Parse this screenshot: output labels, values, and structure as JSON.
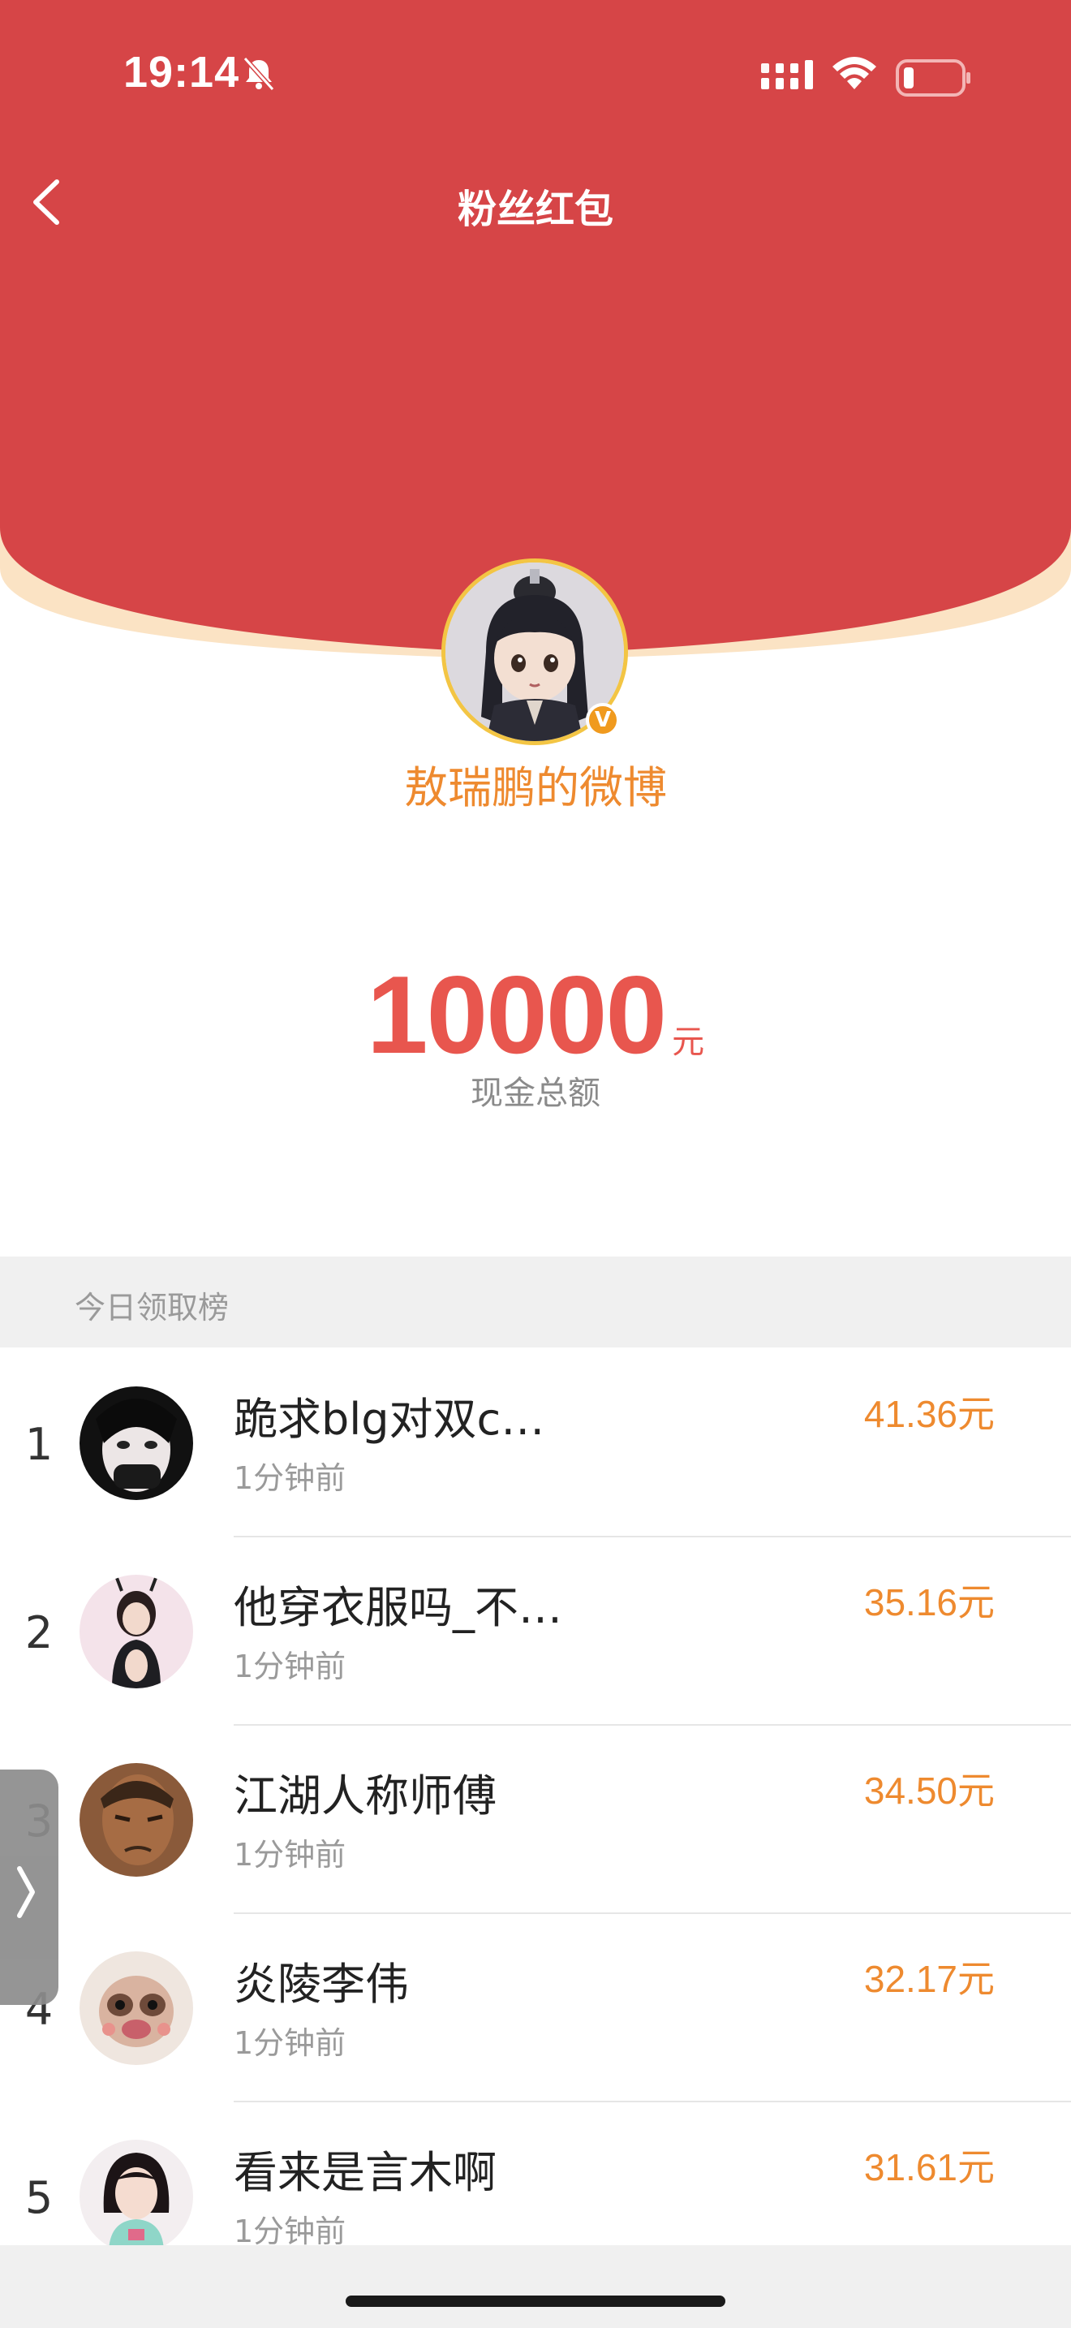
{
  "status_bar": {
    "time": "19:14"
  },
  "nav": {
    "title": "粉丝红包"
  },
  "colors": {
    "header_red": "#d64547",
    "accent_orange": "#ee8a2f",
    "amount_red": "#e8564e"
  },
  "owner": {
    "name": "敖瑞鹏的微博",
    "verified_badge": "V"
  },
  "total": {
    "amount": "10000",
    "unit": "元",
    "label": "现金总额"
  },
  "leaderboard": {
    "title": "今日领取榜",
    "rows": [
      {
        "rank": "1",
        "name": "跪求blg对双c…",
        "time": "1分钟前",
        "amount": "41.36元"
      },
      {
        "rank": "2",
        "name": "他穿衣服吗_不…",
        "time": "1分钟前",
        "amount": "35.16元"
      },
      {
        "rank": "3",
        "name": "江湖人称师傅",
        "time": "1分钟前",
        "amount": "34.50元"
      },
      {
        "rank": "4",
        "name": "炎陵李伟",
        "time": "1分钟前",
        "amount": "32.17元"
      },
      {
        "rank": "5",
        "name": "看来是言木啊",
        "time": "1分钟前",
        "amount": "31.61元"
      }
    ]
  }
}
